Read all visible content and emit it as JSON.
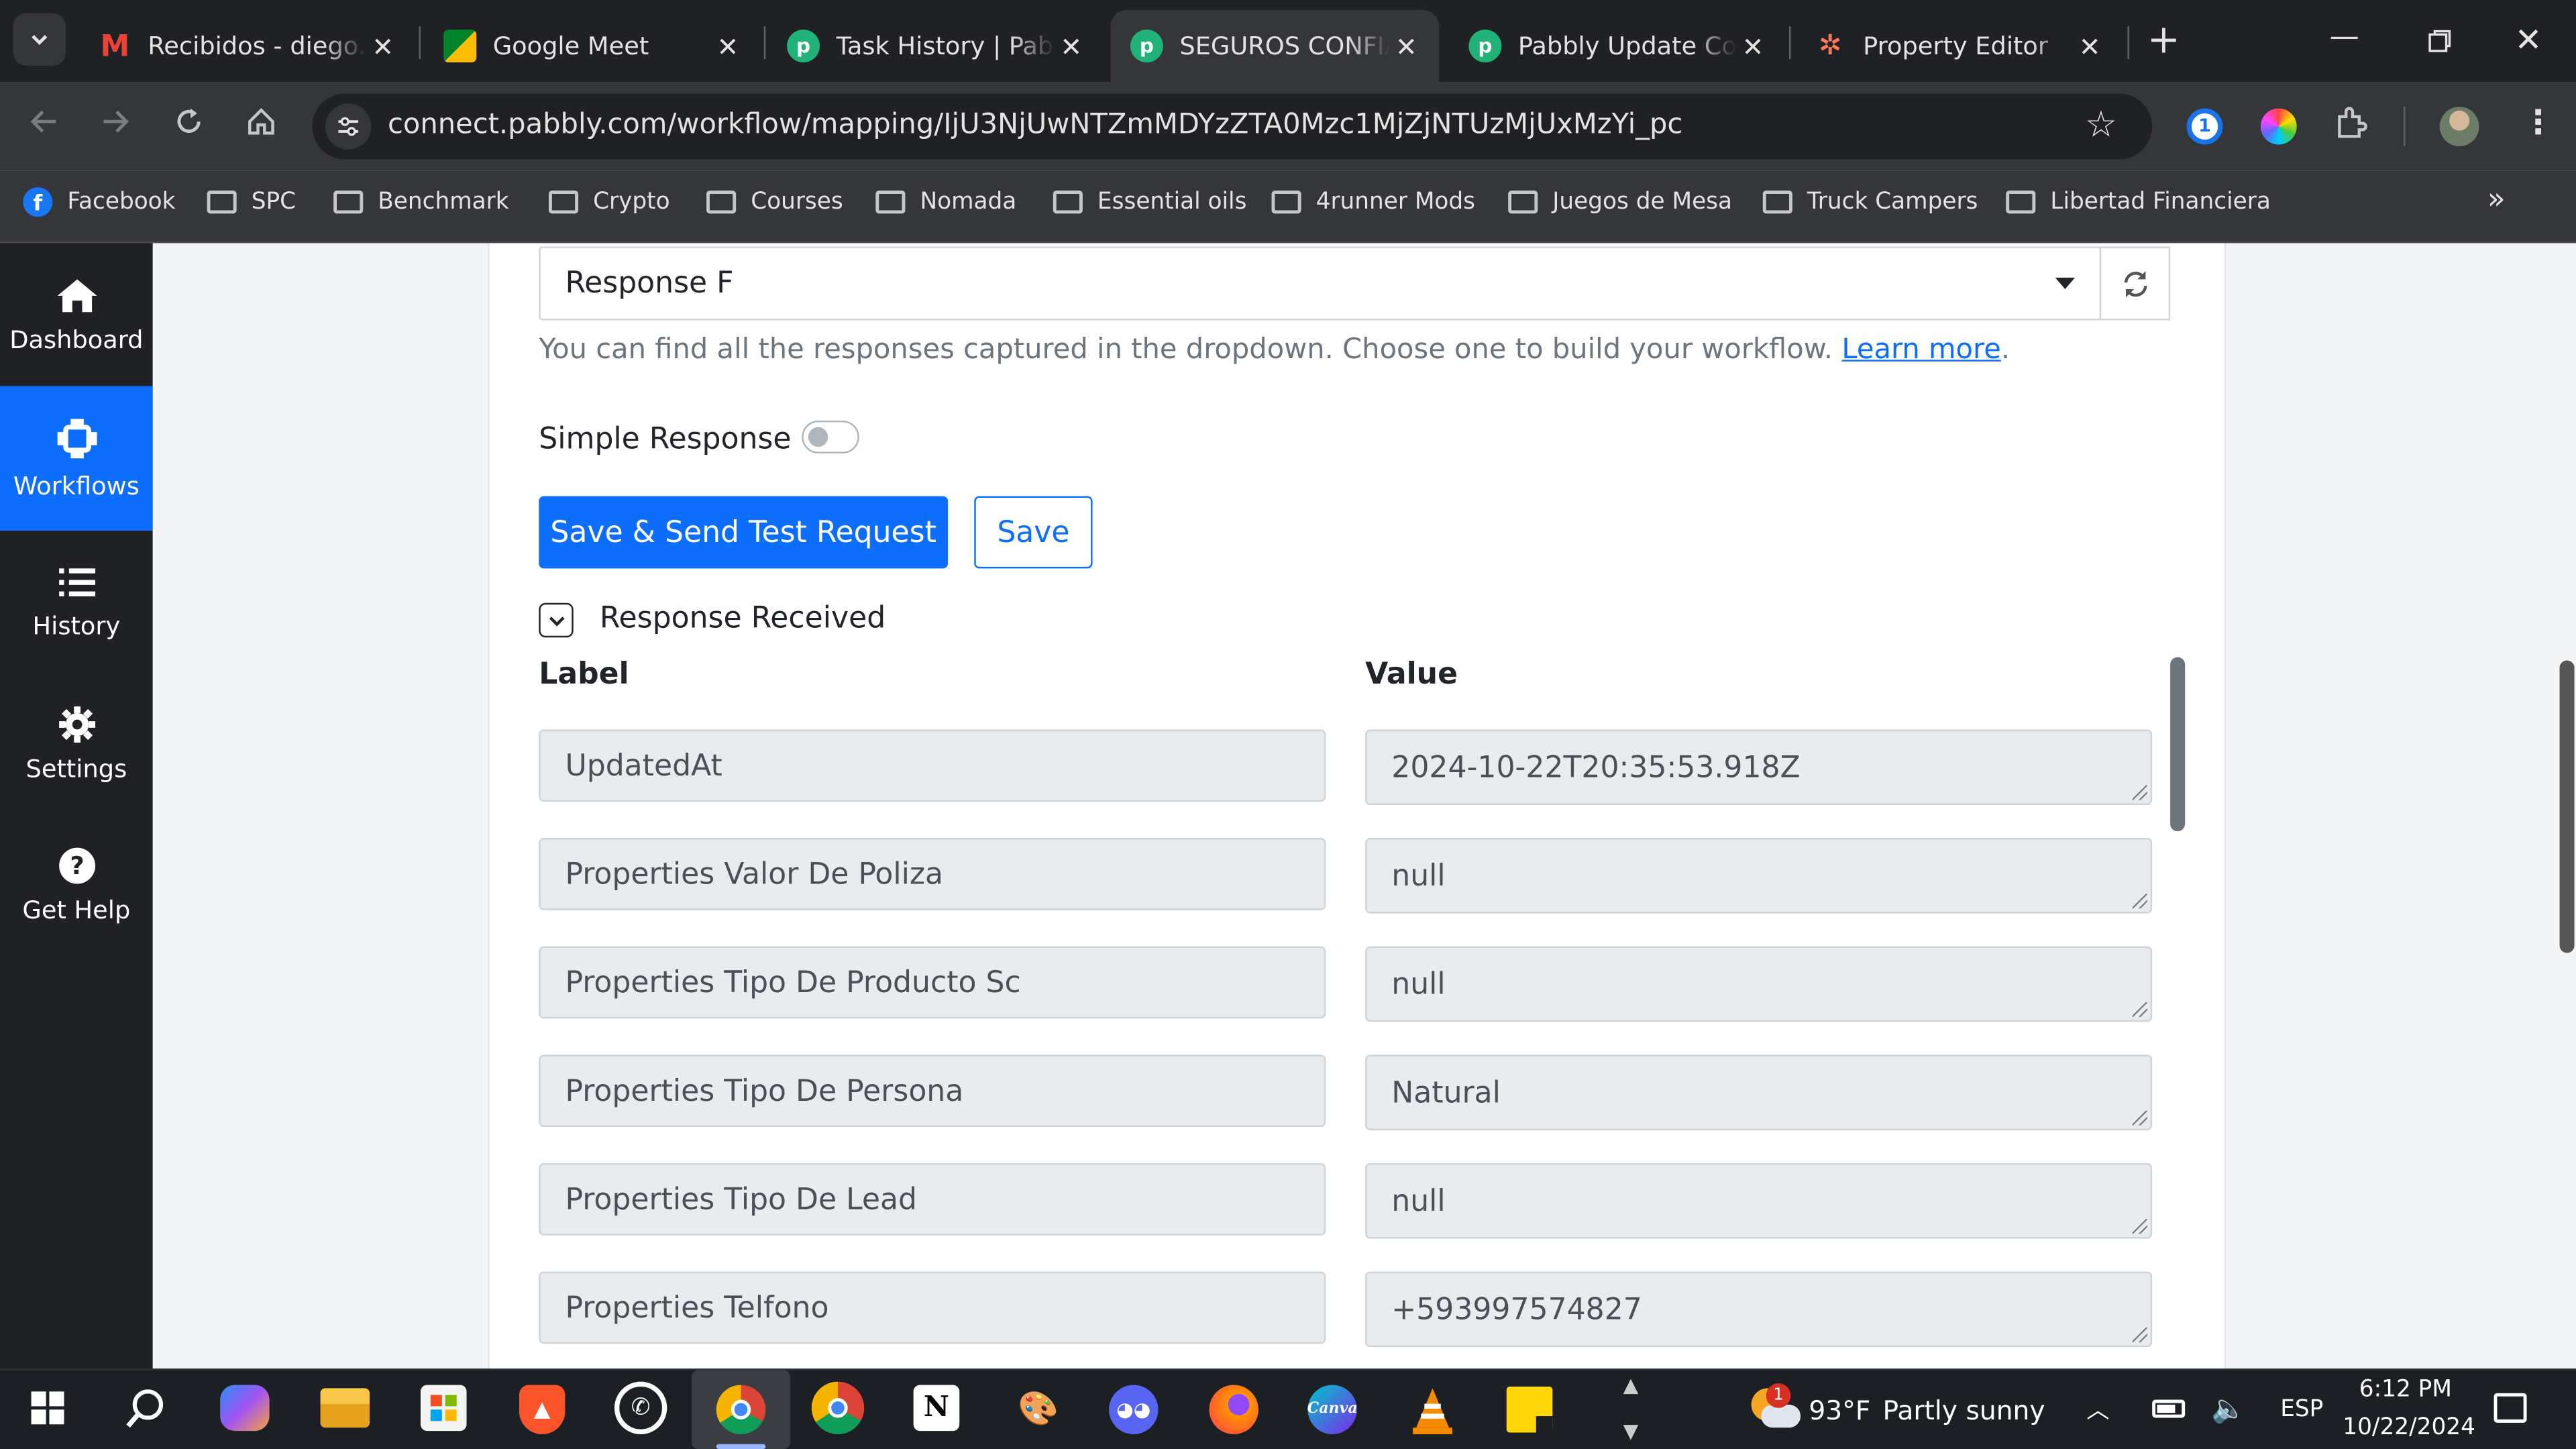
{
  "browser": {
    "tabs": [
      {
        "title": "Recibidos - diego.f",
        "icon": "gmail-icon",
        "color": "#ea4335"
      },
      {
        "title": "Google Meet",
        "icon": "google-meet-icon",
        "color": "#00897b"
      },
      {
        "title": "Task History | Pabbly",
        "icon": "pabbly-icon",
        "color": "#20b276"
      },
      {
        "title": "SEGUROS CONFIANZA",
        "icon": "pabbly-icon",
        "color": "#20b276"
      },
      {
        "title": "Pabbly Update Contact",
        "icon": "pabbly-icon",
        "color": "#20b276"
      },
      {
        "title": "Property Editor",
        "icon": "hubspot-icon",
        "color": "#ff7a59"
      }
    ],
    "url": "connect.pabbly.com/workflow/mapping/IjU3NjUwNTZmMDYzZTA0Mzc1MjZjNTUzMjUxMzYi_pc",
    "bookmarks": [
      "Facebook",
      "SPC",
      "Benchmark",
      "Crypto",
      "Courses",
      "Nomada",
      "Essential oils",
      "4runner Mods",
      "Juegos de Mesa",
      "Truck Campers",
      "Libertad Financiera"
    ]
  },
  "sidebar": {
    "items": [
      {
        "label": "Dashboard",
        "icon": "home-icon"
      },
      {
        "label": "Workflows",
        "icon": "workflows-icon"
      },
      {
        "label": "History",
        "icon": "list-icon"
      },
      {
        "label": "Settings",
        "icon": "gear-icon"
      },
      {
        "label": "Get Help",
        "icon": "question-icon"
      }
    ]
  },
  "main": {
    "response_select": "Response F",
    "help_text": "You can find all the responses captured in the dropdown. Choose one to build your workflow.",
    "help_link": "Learn more",
    "help_suffix": ".",
    "simple_response_label": "Simple Response",
    "simple_response_on": false,
    "send_button": "Save & Send Test Request",
    "save_button": "Save",
    "response_received": "Response Received",
    "label_header": "Label",
    "value_header": "Value",
    "rows": [
      {
        "label": "UpdatedAt",
        "value": "2024-10-22T20:35:53.918Z"
      },
      {
        "label": "Properties Valor De Poliza",
        "value": "null"
      },
      {
        "label": "Properties Tipo De Producto Sc",
        "value": "null"
      },
      {
        "label": "Properties Tipo De Persona",
        "value": "Natural"
      },
      {
        "label": "Properties Tipo De Lead",
        "value": "null"
      },
      {
        "label": "Properties Telfono",
        "value": "+593997574827"
      }
    ]
  },
  "taskbar": {
    "apps": [
      "windows-start-icon",
      "search-icon",
      "copilot-icon",
      "file-explorer-icon",
      "microsoft-store-icon",
      "brave-icon",
      "whatsapp-icon",
      "chrome-icon",
      "chrome-profile-icon",
      "notion-icon",
      "paint-icon",
      "discord-icon",
      "firefox-icon",
      "canva-icon",
      "vlc-icon",
      "sticky-notes-icon"
    ],
    "weather_temp": "93°F",
    "weather_text": "Partly sunny",
    "weather_badge": "1",
    "language": "ESP",
    "time": "6:12 PM",
    "date": "10/22/2024"
  }
}
